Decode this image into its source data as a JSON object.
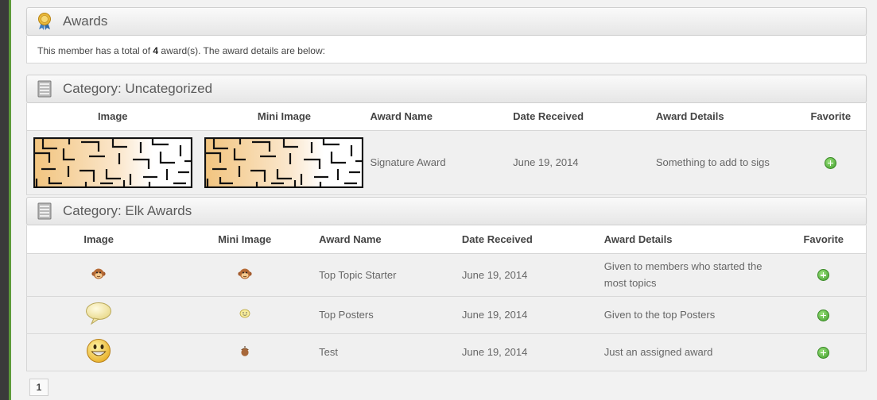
{
  "awards_header": {
    "title": "Awards",
    "icon": "ribbon-icon"
  },
  "summary": {
    "prefix": "This member has a total of ",
    "count": "4",
    "suffix": " award(s). The award details are below:"
  },
  "categories": [
    {
      "title": "Category: Uncategorized",
      "icon": "server-icon",
      "columns": [
        "Image",
        "Mini Image",
        "Award Name",
        "Date Received",
        "Award Details",
        "Favorite"
      ],
      "rows": [
        {
          "image": "maze-image",
          "mini_image": "maze-image",
          "award_name": "Signature Award",
          "date_received": "June 19, 2014",
          "award_details": "Something to add to sigs",
          "favorite": "add-favorite-icon"
        }
      ]
    },
    {
      "title": "Category: Elk Awards",
      "icon": "server-icon",
      "columns": [
        "Image",
        "Mini Image",
        "Award Name",
        "Date Received",
        "Award Details",
        "Favorite"
      ],
      "rows": [
        {
          "image": "monkey-icon",
          "mini_image": "monkey-icon",
          "award_name": "Top Topic Starter",
          "date_received": "June 19, 2014",
          "award_details": "Given to members who started the most topics",
          "favorite": "add-favorite-icon"
        },
        {
          "image": "speech-bubble-icon",
          "mini_image": "small-smiley-icon",
          "award_name": "Top Posters",
          "date_received": "June 19, 2014",
          "award_details": "Given to the top Posters",
          "favorite": "add-favorite-icon"
        },
        {
          "image": "grinning-smiley-icon",
          "mini_image": "acorn-icon",
          "award_name": "Test",
          "date_received": "June 19, 2014",
          "award_details": "Just an assigned award",
          "favorite": "add-favorite-icon"
        }
      ]
    }
  ],
  "pagination": {
    "current_page": "1"
  },
  "colors": {
    "accent_green": "#5d9a3a",
    "favorite_green": "#3f9c2a"
  }
}
